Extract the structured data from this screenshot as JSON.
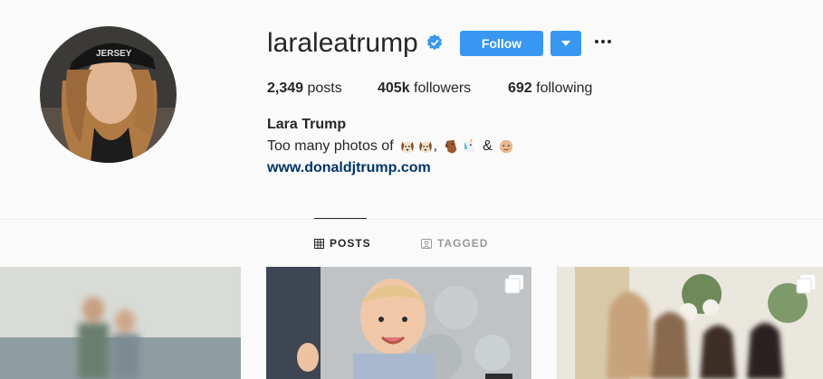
{
  "profile": {
    "username": "laraleatrump",
    "full_name": "Lara Trump",
    "bio_text": "Too many photos of",
    "bio_sep1": ",",
    "bio_sep2": "&",
    "bio_emojis": [
      "dog-face",
      "dog-face",
      "horse-face",
      "unicorn-face",
      "baby-face"
    ],
    "website": "www.donaldjtrump.com",
    "verified": true
  },
  "actions": {
    "follow_label": "Follow"
  },
  "stats": {
    "posts_count": "2,349",
    "posts_label": "posts",
    "followers_count": "405k",
    "followers_label": "followers",
    "following_count": "692",
    "following_label": "following"
  },
  "tabs": [
    {
      "label": "POSTS",
      "active": true
    },
    {
      "label": "TAGGED",
      "active": false
    }
  ],
  "colors": {
    "accent": "#3897f0",
    "link": "#003569",
    "background": "#fafafa"
  }
}
